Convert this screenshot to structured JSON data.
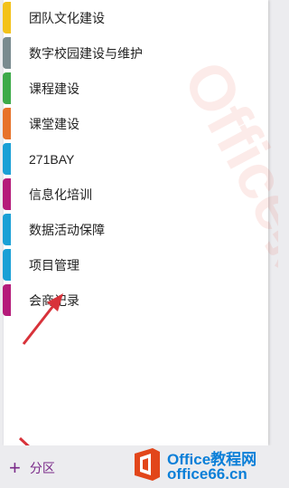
{
  "sections": [
    {
      "label": "团队文化建设",
      "color": "#f3c21a"
    },
    {
      "label": "数字校园建设与维护",
      "color": "#7a8b8f"
    },
    {
      "label": "课程建设",
      "color": "#3daa49"
    },
    {
      "label": "课堂建设",
      "color": "#e7722a"
    },
    {
      "label": "271BAY",
      "color": "#1aa0d6"
    },
    {
      "label": "信息化培训",
      "color": "#b51b7a"
    },
    {
      "label": "数据活动保障",
      "color": "#1aa0d6"
    },
    {
      "label": "项目管理",
      "color": "#1aa0d6"
    },
    {
      "label": "会商记录",
      "color": "#b51b7a"
    }
  ],
  "bottom": {
    "add_label": "分区"
  },
  "logo": {
    "line1": "Office教程网",
    "line2": "office66.cn"
  },
  "watermark": {
    "text": "Office教程网"
  }
}
